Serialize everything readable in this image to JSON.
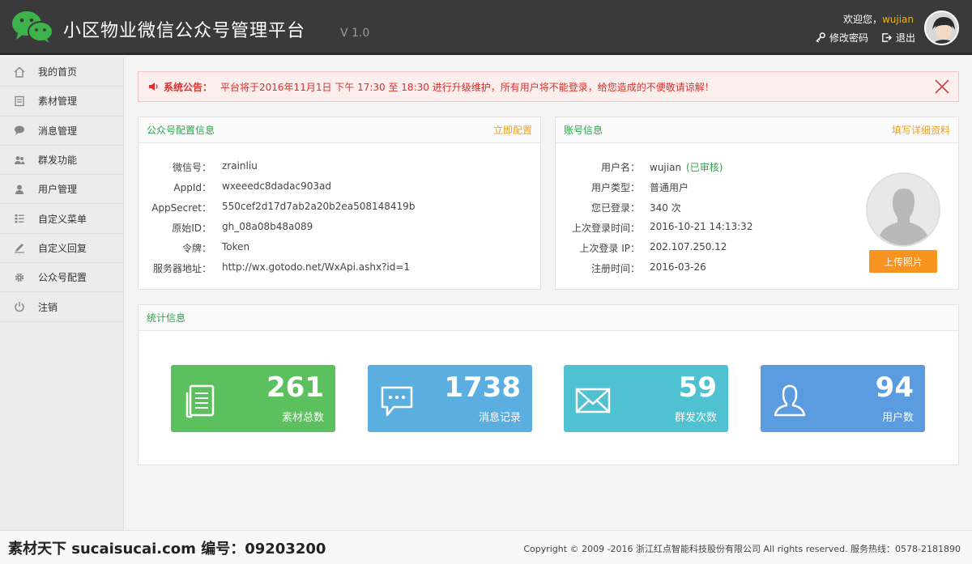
{
  "header": {
    "title": "小区物业微信公众号管理平台",
    "version": "V 1.0",
    "welcome_prefix": "欢迎您，",
    "username": "wujian",
    "change_password": "修改密码",
    "logout": "退出"
  },
  "sidebar": {
    "items": [
      {
        "label": "我的首页",
        "icon": "home-icon"
      },
      {
        "label": "素材管理",
        "icon": "document-icon"
      },
      {
        "label": "消息管理",
        "icon": "chat-icon"
      },
      {
        "label": "群发功能",
        "icon": "users-icon"
      },
      {
        "label": "用户管理",
        "icon": "user-icon"
      },
      {
        "label": "自定义菜单",
        "icon": "menu-icon"
      },
      {
        "label": "自定义回复",
        "icon": "edit-icon"
      },
      {
        "label": "公众号配置",
        "icon": "gear-icon"
      },
      {
        "label": "注销",
        "icon": "power-icon"
      }
    ]
  },
  "notice": {
    "label": "系统公告：",
    "text": "平台将于2016年11月1日 下午 17:30 至 18:30 进行升级维护，所有用户将不能登录，给您造成的不便敬请谅解！"
  },
  "config_panel": {
    "title": "公众号配置信息",
    "action": "立即配置",
    "rows": [
      {
        "key": "微信号：",
        "value": "zrainliu"
      },
      {
        "key": "AppId：",
        "value": "wxeeedc8dadac903ad"
      },
      {
        "key": "AppSecret：",
        "value": "550cef2d17d7ab2a20b2ea508148419b"
      },
      {
        "key": "原始ID：",
        "value": "gh_08a08b48a089"
      },
      {
        "key": "令牌：",
        "value": "Token"
      },
      {
        "key": "服务器地址：",
        "value": "http://wx.gotodo.net/WxApi.ashx?id=1"
      }
    ]
  },
  "account_panel": {
    "title": "账号信息",
    "action": "填写详细资料",
    "rows": [
      {
        "key": "用户名：",
        "value": "wujian",
        "extra": "(已审核)"
      },
      {
        "key": "用户类型：",
        "value": "普通用户"
      },
      {
        "key": "您已登录：",
        "value": "340 次"
      },
      {
        "key": "上次登录时间：",
        "value": "2016-10-21 14:13:32"
      },
      {
        "key": "上次登录 IP：",
        "value": "202.107.250.12"
      },
      {
        "key": "注册时间：",
        "value": "2016-03-26"
      }
    ],
    "upload_label": "上传照片"
  },
  "stats_panel": {
    "title": "统计信息",
    "cards": [
      {
        "value": "261",
        "label": "素材总数",
        "color": "#5cc05e",
        "icon": "document-icon"
      },
      {
        "value": "1738",
        "label": "消息记录",
        "color": "#5aaee0",
        "icon": "chat-icon"
      },
      {
        "value": "59",
        "label": "群发次数",
        "color": "#4fc1d1",
        "icon": "mail-icon"
      },
      {
        "value": "94",
        "label": "用户数",
        "color": "#5b9be0",
        "icon": "user-icon"
      }
    ]
  },
  "footer": {
    "watermark": "素材天下 sucaisucai.com  编号：09203200",
    "copyright": "Copyright © 2009 -2016 浙江红点智能科技股份有限公司  All rights reserved.  服务热线：0578-2181890"
  },
  "colors": {
    "header_bg": "#3a3a3a",
    "accent_green": "#2aa54a",
    "accent_orange": "#f7931e",
    "notice_red": "#d9322c"
  }
}
